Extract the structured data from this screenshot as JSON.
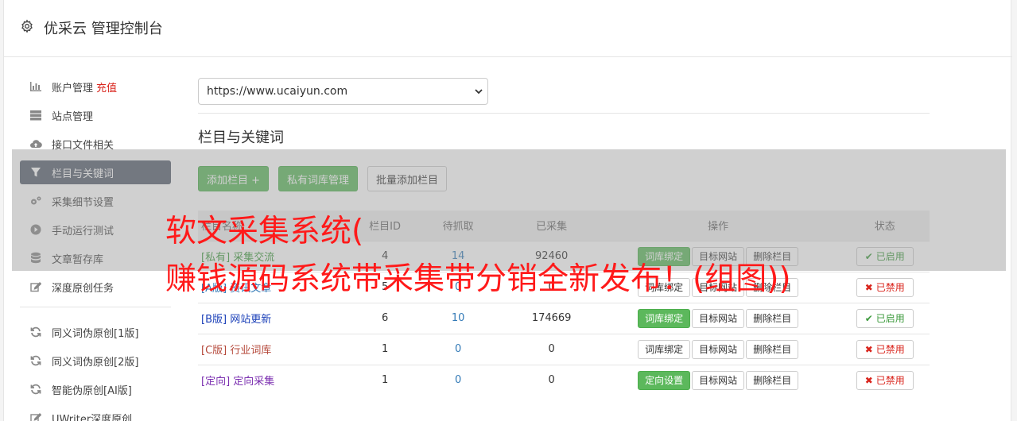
{
  "header": {
    "title": "优采云 管理控制台",
    "icon": "gear-icon"
  },
  "sidebar": {
    "items": [
      {
        "label": "账户管理",
        "extra": "充值",
        "icon": "bar-chart-icon",
        "color_extra": "#d9241c"
      },
      {
        "label": "站点管理",
        "icon": "server-icon"
      },
      {
        "label": "接口文件相关",
        "icon": "cloud-upload-icon"
      },
      {
        "label": "栏目与关键词",
        "icon": "filter-icon",
        "active": true
      },
      {
        "label": "采集细节设置",
        "icon": "cogs-icon"
      },
      {
        "label": "手动运行测试",
        "icon": "play-circle-icon"
      },
      {
        "label": "文章暂存库",
        "icon": "database-icon"
      },
      {
        "label": "深度原创任务",
        "icon": "edit-icon"
      }
    ],
    "items2": [
      {
        "label": "同义词伪原创[1版]",
        "icon": "refresh-icon"
      },
      {
        "label": "同义词伪原创[2版]",
        "icon": "refresh-icon"
      },
      {
        "label": "智能伪原创[AI版]",
        "icon": "refresh-icon"
      },
      {
        "label": "UWriter深度原创",
        "icon": "edit-icon"
      }
    ]
  },
  "main": {
    "site_select": {
      "value": "https://www.ucaiyun.com"
    },
    "section_title": "栏目与关键词",
    "toolbar": {
      "add": "添加栏目 +",
      "private_lib": "私有词库管理",
      "batch_add": "批量添加栏目"
    },
    "table": {
      "headers": [
        "栏目名称",
        "栏目ID",
        "待抓取",
        "已采集",
        "操作",
        "状态"
      ],
      "rows": [
        {
          "tag": "[私有]",
          "name": "采集交流",
          "color": "#3c9a3c",
          "id": "4",
          "pending": "14",
          "collected": "92460",
          "bind": "词库绑定",
          "bind_green": true,
          "target": "目标网站",
          "delete": "删除栏目",
          "status": "已启用",
          "enabled": true
        },
        {
          "tag": "[A版]",
          "name": "资讯文章",
          "color": "#337ab7",
          "id": "5",
          "pending": "0",
          "collected": "0",
          "bind": "词库绑定",
          "bind_green": false,
          "target": "目标网站",
          "delete": "删除栏目",
          "status": "已禁用",
          "enabled": false
        },
        {
          "tag": "[B版]",
          "name": "网站更新",
          "color": "#1a3fb8",
          "id": "6",
          "pending": "10",
          "collected": "174669",
          "bind": "词库绑定",
          "bind_green": true,
          "target": "目标网站",
          "delete": "删除栏目",
          "status": "已启用",
          "enabled": true
        },
        {
          "tag": "[C版]",
          "name": "行业词库",
          "color": "#b5483a",
          "id": "1",
          "pending": "0",
          "collected": "0",
          "bind": "词库绑定",
          "bind_green": false,
          "target": "目标网站",
          "delete": "删除栏目",
          "status": "已禁用",
          "enabled": false
        },
        {
          "tag": "[定向]",
          "name": "定向采集",
          "color": "#7b2fb0",
          "id": "1",
          "pending": "0",
          "collected": "0",
          "bind": "定向设置",
          "bind_green": true,
          "target": "目标网站",
          "delete": "删除栏目",
          "status": "已禁用",
          "enabled": false
        }
      ]
    }
  },
  "watermark": {
    "line1": "软文采集系统(",
    "line2": "赚钱源码系统带采集带分销全新发布！(组图))",
    "color": "#ff1a1a"
  }
}
